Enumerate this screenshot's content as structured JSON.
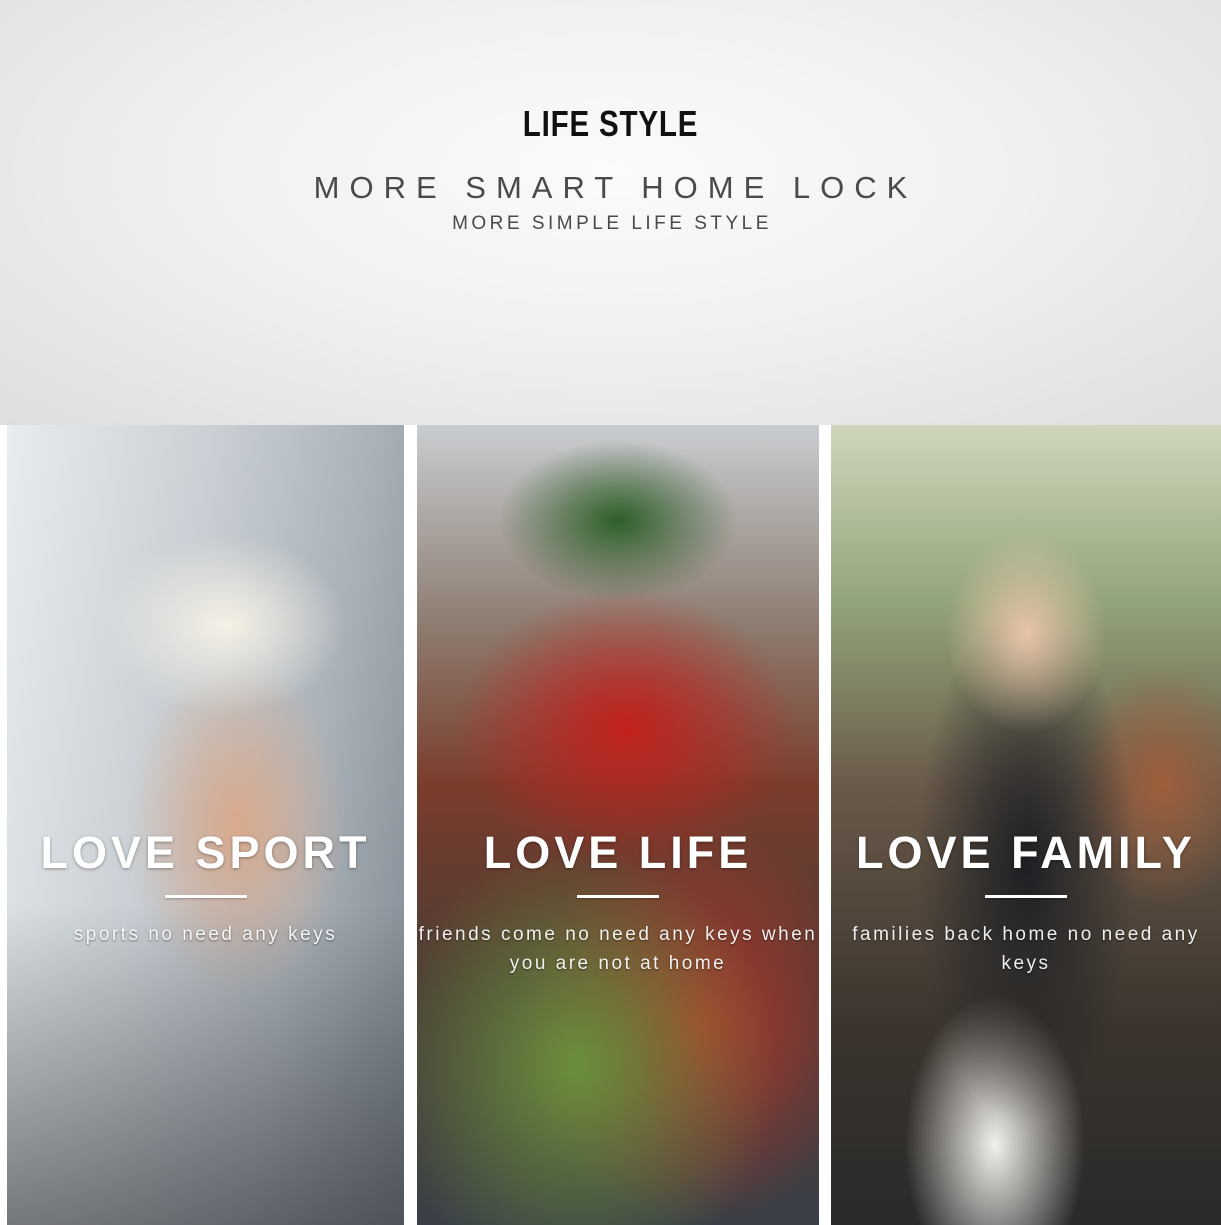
{
  "header": {
    "title": "LIFE STYLE",
    "subtitle": "MORE SMART HOME LOCK",
    "tagline": "MORE SIMPLE LIFE STYLE"
  },
  "panels": [
    {
      "heading": "LOVE SPORT",
      "caption": "sports no need any keys",
      "photo": "woman-jogging-photo"
    },
    {
      "heading": "LOVE LIFE",
      "caption": "friends come no need any keys when you are not at home",
      "photo": "christmas-gathering-photo"
    },
    {
      "heading": "LOVE FAMILY",
      "caption": "families back home no need any keys",
      "photo": "family-portrait-photo"
    }
  ],
  "colors": {
    "title_text": "#111111",
    "subtitle_text": "#4a4a4a",
    "panel_text": "#ffffff"
  }
}
